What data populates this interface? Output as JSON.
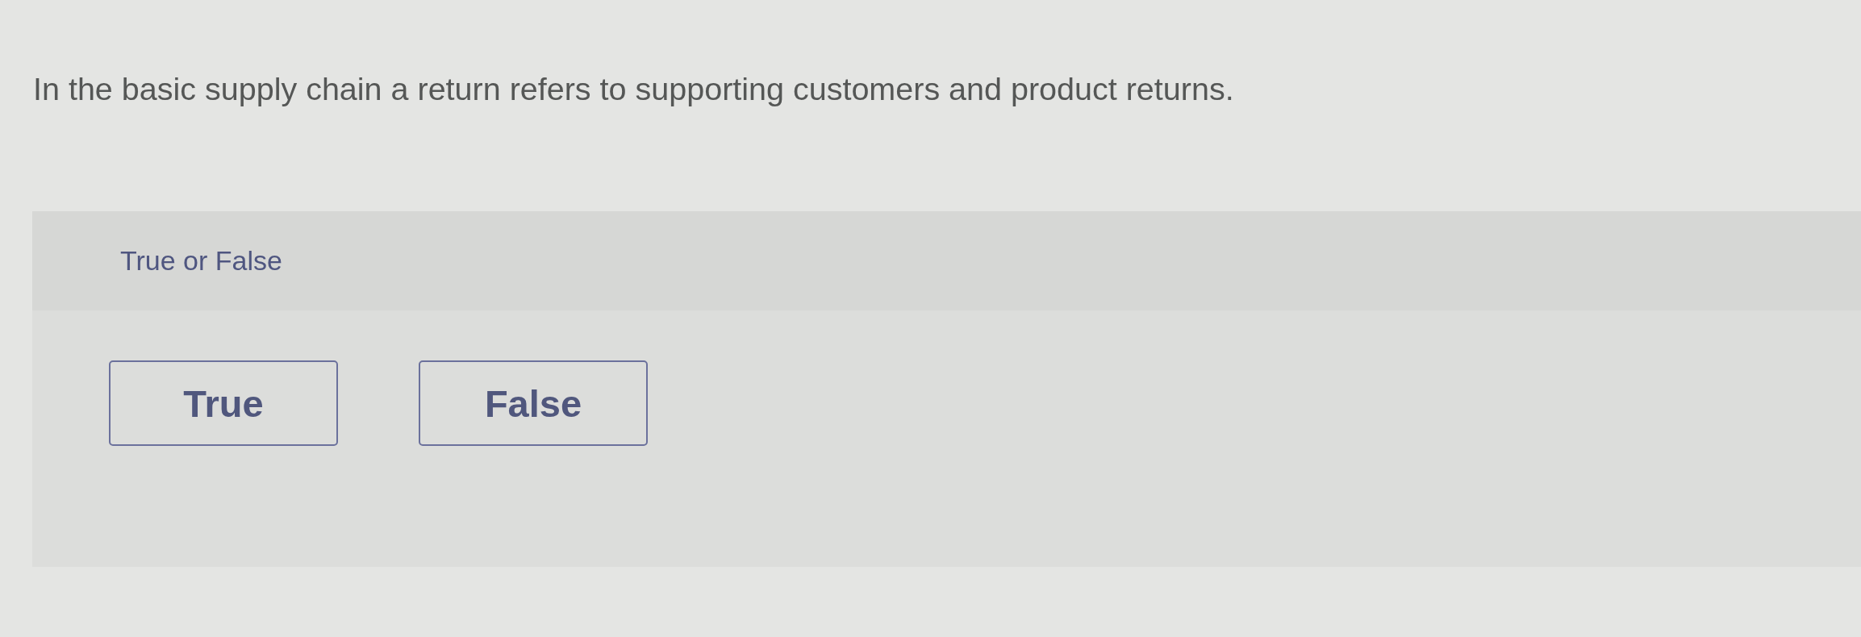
{
  "question": {
    "text": "In the basic supply chain a return refers to supporting customers and product returns."
  },
  "answer_panel": {
    "prompt": "True or False",
    "options": [
      {
        "label": "True",
        "selected": false
      },
      {
        "label": "False",
        "selected": false
      }
    ]
  }
}
